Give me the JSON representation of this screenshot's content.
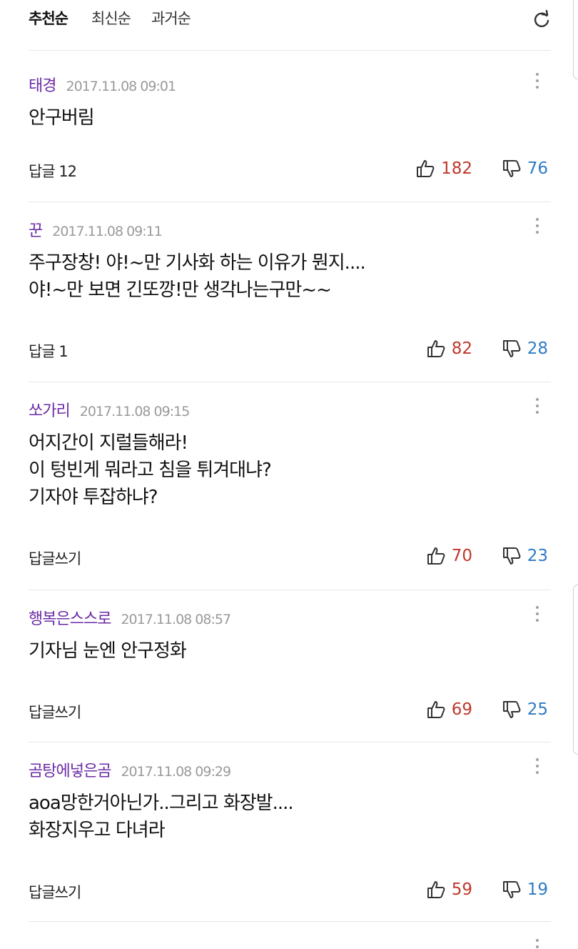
{
  "sort_tabs": [
    {
      "label": "추천순",
      "active": true
    },
    {
      "label": "최신순",
      "active": false
    },
    {
      "label": "과거순",
      "active": false
    }
  ],
  "refresh_icon": "refresh-icon",
  "comments": [
    {
      "author": "태경",
      "time": "2017.11.08 09:01",
      "lines": [
        "안구버림"
      ],
      "reply": "답글 12",
      "up": "182",
      "down": "76"
    },
    {
      "author": "꾼",
      "time": "2017.11.08 09:11",
      "lines": [
        "주구장창!  야!~만 기사화 하는 이유가  뭔지....",
        "야!~만  보면  긴또깡!만  생각나는구만~~"
      ],
      "reply": "답글 1",
      "up": "82",
      "down": "28"
    },
    {
      "author": "쏘가리",
      "time": "2017.11.08 09:15",
      "lines": [
        "어지간이  지럴들해라!",
        "이 텅빈게  뭐라고 침을  튀겨대냐?",
        "기자야  투잡하냐?"
      ],
      "reply": "답글쓰기",
      "up": "70",
      "down": "23"
    },
    {
      "author": "행복은스스로",
      "time": "2017.11.08 08:57",
      "lines": [
        "기자님 눈엔 안구정화"
      ],
      "reply": "답글쓰기",
      "up": "69",
      "down": "25"
    },
    {
      "author": "곰탕에넣은곰",
      "time": "2017.11.08 09:29",
      "lines": [
        "aoa망한거아닌가..그리고 화장발....",
        "화장지우고 다녀라"
      ],
      "reply": "답글쓰기",
      "up": "59",
      "down": "19"
    }
  ],
  "colors": {
    "author": "#6b2ba6",
    "up": "#c0392b",
    "down": "#2e7bc4",
    "divider": "#e6e6e6"
  }
}
